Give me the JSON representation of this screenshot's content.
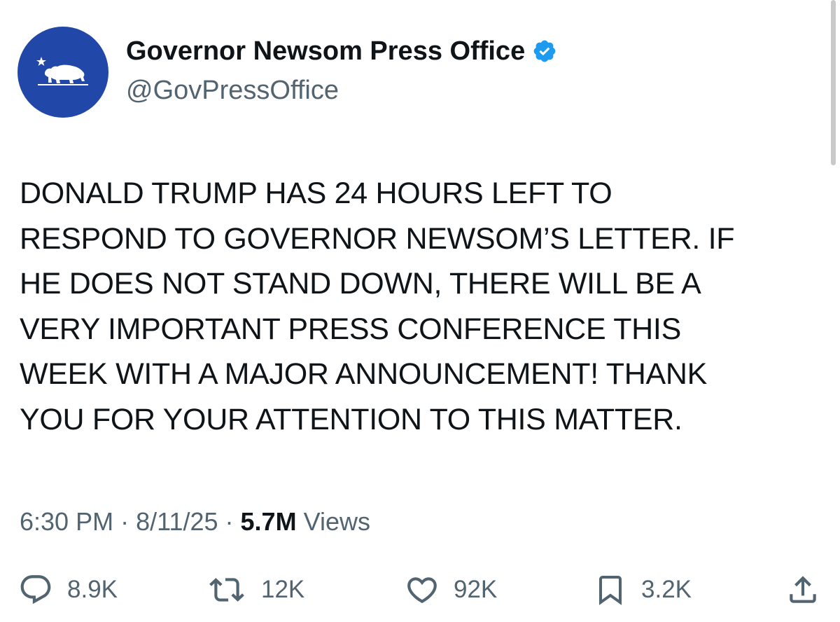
{
  "author": {
    "display_name": "Governor Newsom Press Office",
    "handle": "@GovPressOffice",
    "verified": true,
    "avatar_icon": "california-bear-star-icon",
    "avatar_color": "#2148a8",
    "verified_color": "#1d9bf0"
  },
  "tweet": {
    "text_lines": [
      "DONALD TRUMP HAS 24 HOURS LEFT TO",
      "RESPOND TO GOVERNOR NEWSOM’S LETTER. IF",
      "HE DOES NOT STAND DOWN, THERE WILL BE A",
      "VERY IMPORTANT PRESS CONFERENCE THIS",
      "WEEK WITH A MAJOR ANNOUNCEMENT! THANK",
      "YOU FOR YOUR ATTENTION TO THIS MATTER."
    ]
  },
  "meta": {
    "time": "6:30 PM",
    "separator": " · ",
    "date": "8/11/25",
    "views_count": "5.7M",
    "views_label": "Views"
  },
  "actions": {
    "replies": {
      "icon": "reply-icon",
      "count": "8.9K"
    },
    "reposts": {
      "icon": "repost-icon",
      "count": "12K"
    },
    "likes": {
      "icon": "heart-icon",
      "count": "92K"
    },
    "bookmarks": {
      "icon": "bookmark-icon",
      "count": "3.2K"
    },
    "share": {
      "icon": "share-icon"
    }
  }
}
